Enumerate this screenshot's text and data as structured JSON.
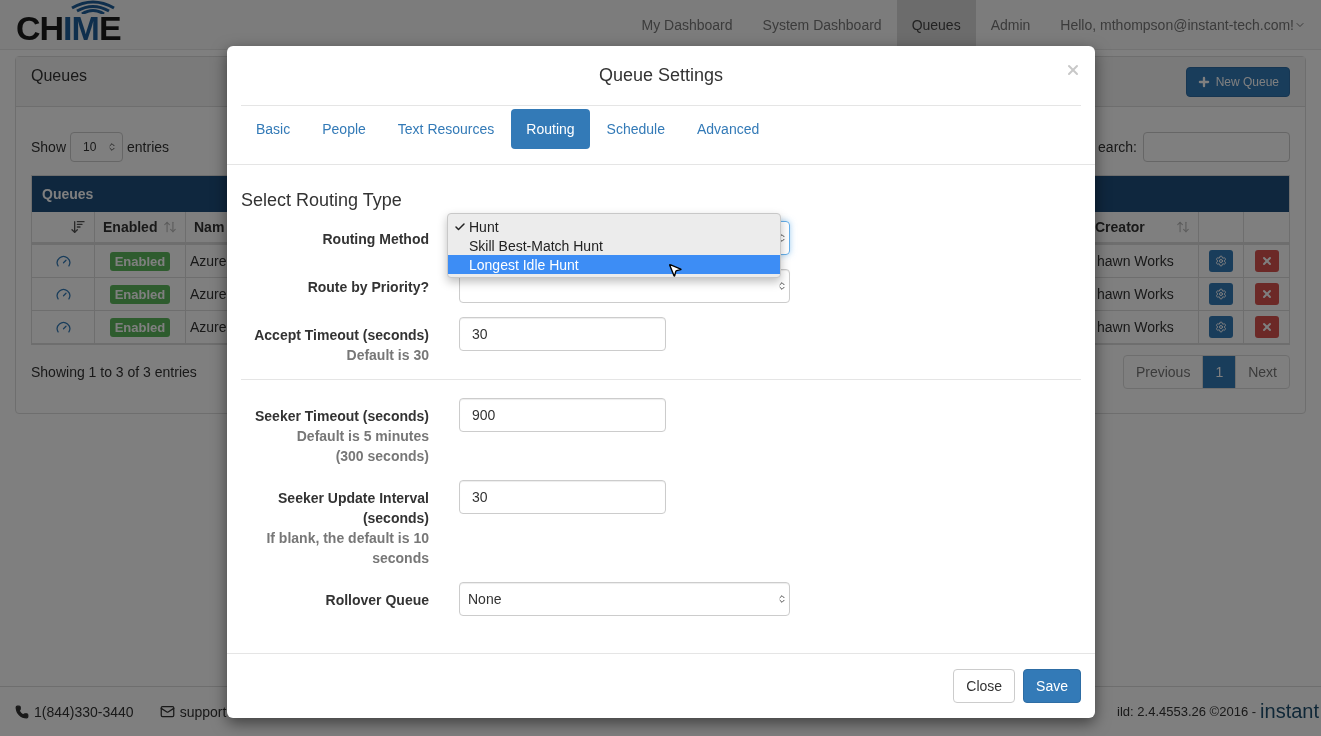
{
  "navbar": {
    "logo": [
      {
        "text": "CH",
        "accent": false
      },
      {
        "text": "IM",
        "accent": true
      },
      {
        "text": "E",
        "accent": false
      }
    ],
    "items": [
      {
        "label": "My Dashboard",
        "selected": false
      },
      {
        "label": "System Dashboard",
        "selected": false
      },
      {
        "label": "Queues",
        "selected": true
      },
      {
        "label": "Admin",
        "selected": false
      }
    ],
    "user_menu": "Hello, mthompson@instant-tech.com!"
  },
  "panel": {
    "title": "Queues",
    "new_button": "New Queue",
    "show_label": "Show",
    "page_size": "10",
    "entries_label": "entries",
    "search_label": "earch:",
    "table": {
      "title": "Queues",
      "columns": [
        "Enabled",
        "Nam",
        "Creator"
      ],
      "rows": [
        {
          "status": "Enabled",
          "name": "Azure",
          "creator": "hawn Works"
        },
        {
          "status": "Enabled",
          "name": "Azure",
          "creator": "hawn Works"
        },
        {
          "status": "Enabled",
          "name": "Azure",
          "creator": "hawn Works"
        }
      ]
    },
    "info": "Showing 1 to 3 of 3 entries",
    "pagination": [
      {
        "label": "Previous",
        "selected": false
      },
      {
        "label": "1",
        "selected": true
      },
      {
        "label": "Next",
        "selected": false
      }
    ]
  },
  "footer": {
    "phone": "1(844)330-3440",
    "email": "support",
    "build": "ild: 2.4.4553.26 ©2016 -",
    "brand": "instant"
  },
  "modal": {
    "title": "Queue Settings",
    "tabs": [
      {
        "label": "Basic",
        "selected": false
      },
      {
        "label": "People",
        "selected": false
      },
      {
        "label": "Text Resources",
        "selected": false
      },
      {
        "label": "Routing",
        "selected": true
      },
      {
        "label": "Schedule",
        "selected": false
      },
      {
        "label": "Advanced",
        "selected": false
      }
    ],
    "section_title": "Select Routing Type",
    "fields": [
      {
        "kind": "select",
        "label": [
          "Routing Method"
        ],
        "focused": true
      },
      {
        "kind": "select",
        "label": [
          "Route by Priority?"
        ],
        "focused": false
      },
      {
        "kind": "text",
        "label": [
          "Accept Timeout (seconds)"
        ],
        "help": [
          "Default is 30"
        ],
        "value": "30"
      },
      {
        "kind": "divider"
      },
      {
        "kind": "text",
        "label": [
          "Seeker Timeout (seconds)"
        ],
        "help": [
          "Default is 5 minutes",
          "(300 seconds)"
        ],
        "value": "900"
      },
      {
        "kind": "text",
        "label": [
          "Seeker Update Interval",
          "(seconds)"
        ],
        "help": [
          "If blank, the default is 10",
          "seconds"
        ],
        "value": "30"
      },
      {
        "kind": "select",
        "label": [
          "Rollover Queue"
        ],
        "value": "None",
        "focused": false
      }
    ],
    "dropdown": {
      "options": [
        {
          "label": "Hunt",
          "checked": true,
          "selected": false
        },
        {
          "label": "Skill Best-Match Hunt",
          "checked": false,
          "selected": false
        },
        {
          "label": "Longest Idle Hunt",
          "checked": false,
          "selected": true
        }
      ]
    },
    "buttons": [
      {
        "label": "Close",
        "kind": "default"
      },
      {
        "label": "Save",
        "kind": "primary"
      }
    ]
  }
}
